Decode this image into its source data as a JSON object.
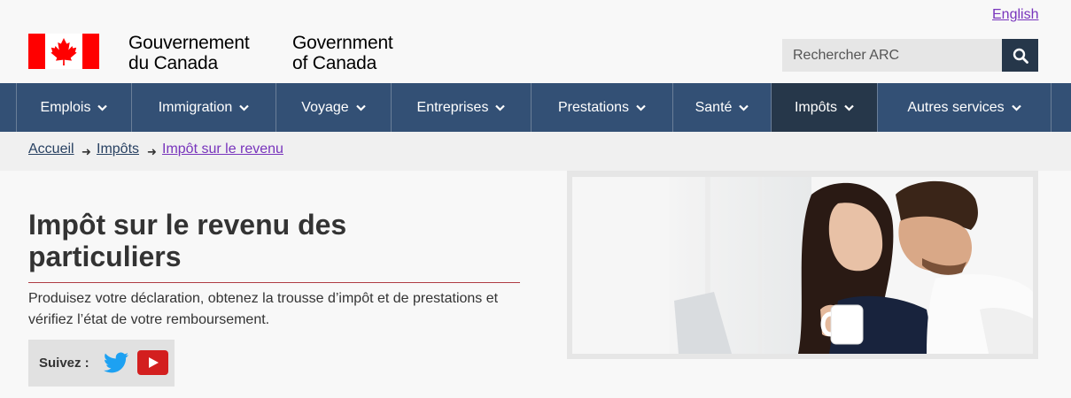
{
  "header": {
    "lang_toggle": "English",
    "gov_fr": [
      "Gouvernement",
      "du Canada"
    ],
    "gov_en": [
      "Government",
      "of Canada"
    ],
    "search": {
      "placeholder": "Rechercher ARC"
    }
  },
  "nav": {
    "items": [
      {
        "label": "Emplois"
      },
      {
        "label": "Immigration"
      },
      {
        "label": "Voyage"
      },
      {
        "label": "Entreprises"
      },
      {
        "label": "Prestations"
      },
      {
        "label": "Santé"
      },
      {
        "label": "Impôts",
        "active": true
      },
      {
        "label": "Autres services"
      }
    ]
  },
  "breadcrumb": [
    "Accueil",
    "Impôts",
    "Impôt sur le revenu"
  ],
  "main": {
    "title": "Impôt sur le revenu des particuliers",
    "lead": "Produisez votre déclaration, obtenez la trousse d’impôt et de prestations et vérifiez l’état de votre remboursement.",
    "follow_label": "Suivez :"
  },
  "colors": {
    "nav_bg": "#335075",
    "nav_active": "#26374a",
    "flag_red": "#ff0000",
    "link_visited": "#7834bc",
    "rule": "#af3c43"
  },
  "icons": [
    "canada-flag",
    "search-icon",
    "chevron-down-icon",
    "twitter-icon",
    "youtube-icon"
  ]
}
